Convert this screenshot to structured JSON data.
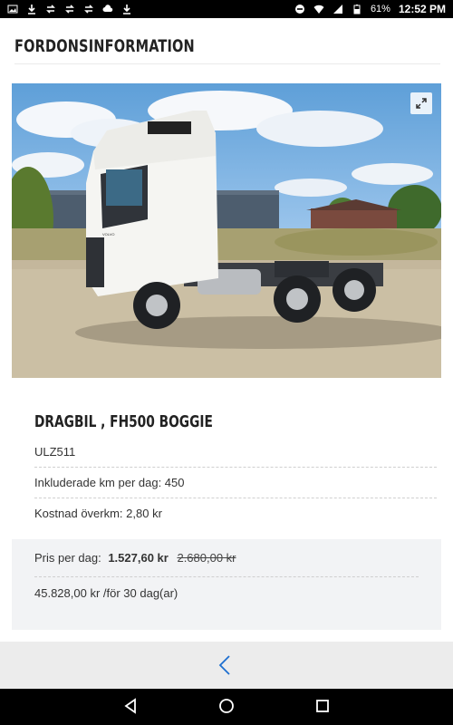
{
  "status_bar": {
    "battery_percent": "61%",
    "time": "12:52 PM"
  },
  "header": {
    "title": "FORDONSINFORMATION"
  },
  "vehicle": {
    "title": "DRAGBIL , FH500 BOGGIE",
    "registration": "ULZ511",
    "included_km": "Inkluderade km per dag: 450",
    "extra_km_cost": "Kostnad överkm: 2,80 kr"
  },
  "pricing": {
    "per_day_label": "Pris per dag:",
    "per_day_price": "1.527,60 kr",
    "per_day_old_price": "2.680,00 kr",
    "total": "45.828,00 kr /för 30 dag(ar)"
  },
  "icons": {
    "expand": "expand-icon",
    "back": "chevron-left-icon"
  },
  "colors": {
    "accent": "#1e6fd0",
    "price_box_bg": "#f2f3f5"
  }
}
